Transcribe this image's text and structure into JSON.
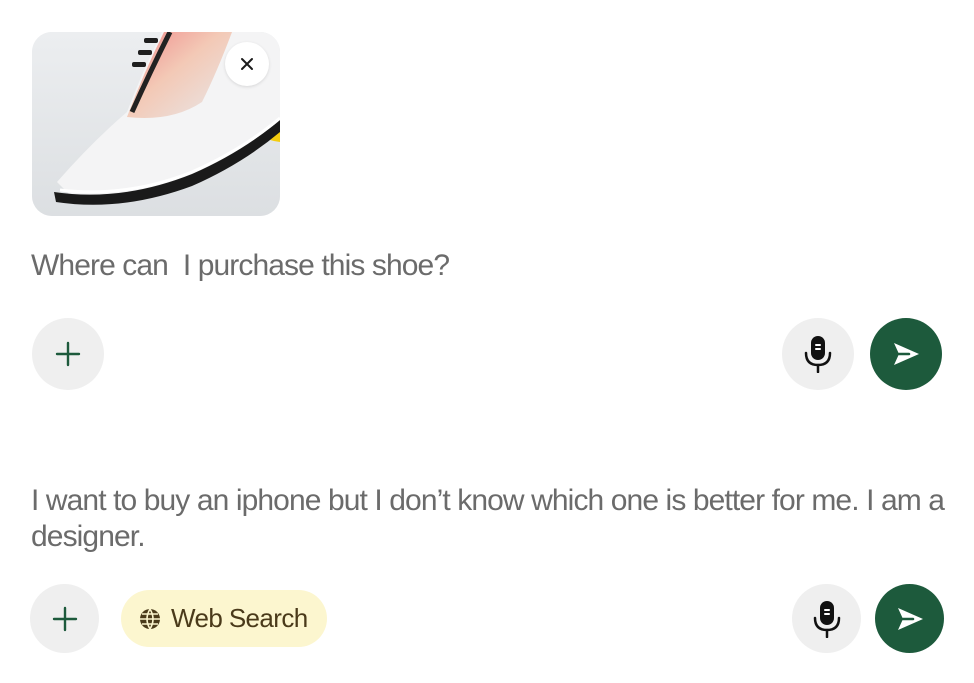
{
  "composers": [
    {
      "attachment": {
        "image_desc": "white sneaker with black sole",
        "remove_icon": "close-icon"
      },
      "prompt": "Where can  I purchase this shoe?",
      "add_icon": "plus-icon",
      "mic_icon": "microphone-icon",
      "send_icon": "send-icon"
    },
    {
      "prompt": "I want to buy an iphone but I don’t know which one is better for me. I am a designer.",
      "add_icon": "plus-icon",
      "tool_chip": {
        "label": "Web Search",
        "icon": "globe-icon"
      },
      "mic_icon": "microphone-icon",
      "send_icon": "send-icon"
    }
  ],
  "colors": {
    "accent_green": "#1d5a3c",
    "button_gray": "#efefef",
    "chip_bg": "#fcf6cf",
    "chip_text": "#4a3a1a",
    "prompt_text": "#6b6b6b"
  }
}
